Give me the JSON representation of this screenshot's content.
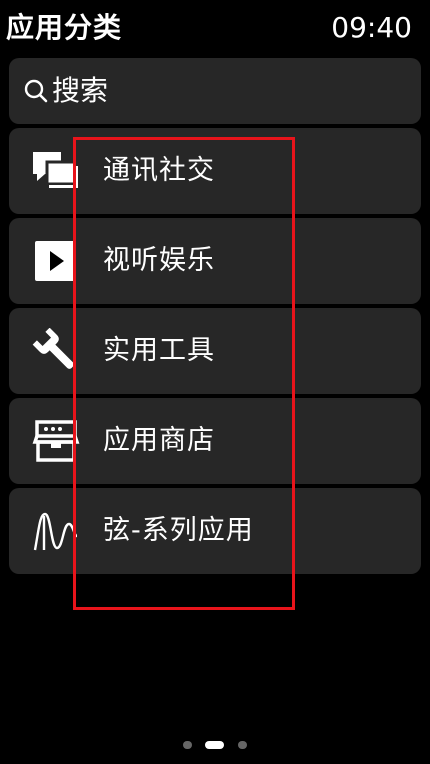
{
  "status": {
    "title": "应用分类",
    "time": "09:40"
  },
  "search": {
    "label": "搜索",
    "icon": "search-icon"
  },
  "categories": [
    {
      "label": "通讯社交",
      "icon": "chat-bubbles-icon"
    },
    {
      "label": "视听娱乐",
      "icon": "play-icon"
    },
    {
      "label": "实用工具",
      "icon": "wrench-icon"
    },
    {
      "label": "应用商店",
      "icon": "store-icon"
    },
    {
      "label": "弦-系列应用",
      "icon": "waveform-icon"
    }
  ],
  "page_indicator": {
    "count": 3,
    "active_index": 1
  },
  "colors": {
    "background": "#000000",
    "card": "#272727",
    "text": "#ffffff",
    "highlight": "#e8141b",
    "dot_inactive": "#666666",
    "dot_active": "#ffffff"
  }
}
